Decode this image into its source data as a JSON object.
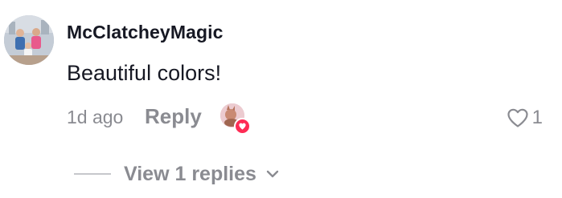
{
  "comment": {
    "username": "McClatcheyMagic",
    "text": "Beautiful colors!",
    "timestamp": "1d ago",
    "reply_label": "Reply",
    "like_count": "1",
    "replies_label": "View 1 replies",
    "creator_liked": true
  },
  "icons": {
    "like": "heart-outline-icon",
    "creator_like_badge": "heart-icon",
    "expand": "chevron-down-icon"
  },
  "colors": {
    "text_primary": "#161823",
    "text_secondary": "#8a8b91",
    "heart_badge": "#fe2c55"
  }
}
